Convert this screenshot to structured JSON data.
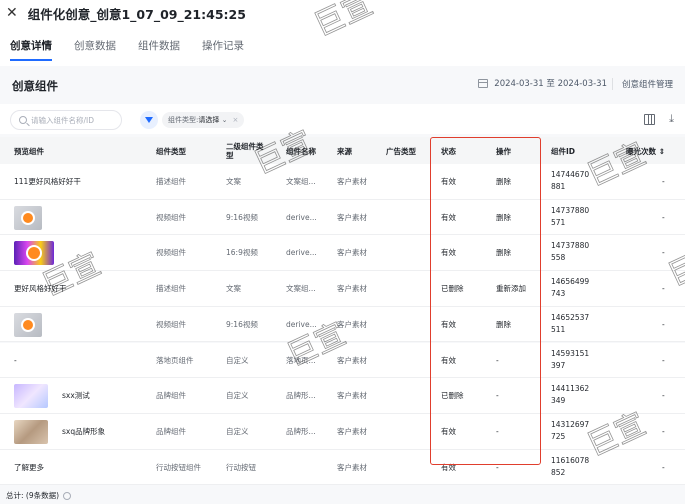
{
  "header": {
    "close_icon": "close-icon",
    "title": "组件化创意_创意1_07_09_21:45:25"
  },
  "tabs": [
    {
      "label": "创意详情"
    },
    {
      "label": "创意数据"
    },
    {
      "label": "组件数据"
    },
    {
      "label": "操作记录"
    }
  ],
  "section": {
    "title": "创意组件",
    "date_range": "2024-03-31 至 2024-03-31",
    "manage_label": "创意组件管理"
  },
  "toolbar": {
    "search_placeholder": "请输入组件名称/ID",
    "filter_prefix": "组件类型:",
    "filter_value": "请选择"
  },
  "columns": [
    "预览组件",
    "组件类型",
    "二级组件类型",
    "组件名称",
    "来源",
    "广告类型",
    "状态",
    "操作",
    "组件ID",
    "曝光次数"
  ],
  "rows": [
    {
      "preview_text": "111更好风格好好干",
      "thumb": "",
      "type": "描述组件",
      "subtype": "文案",
      "name": "文案组...",
      "source": "客户素材",
      "ad_type": "",
      "status": "有效",
      "op": "删除",
      "id1": "14744670",
      "id2": "881",
      "views": "-"
    },
    {
      "preview_text": "",
      "thumb": "video",
      "type": "视频组件",
      "subtype": "9:16视频",
      "name": "derive...",
      "source": "客户素材",
      "ad_type": "",
      "status": "有效",
      "op": "删除",
      "id1": "14737880",
      "id2": "571",
      "views": "-"
    },
    {
      "preview_text": "",
      "thumb": "hor",
      "type": "视频组件",
      "subtype": "16:9视频",
      "name": "derive...",
      "source": "客户素材",
      "ad_type": "",
      "status": "有效",
      "op": "删除",
      "id1": "14737880",
      "id2": "558",
      "views": "-"
    },
    {
      "preview_text": "更好风格好好干",
      "thumb": "",
      "type": "描述组件",
      "subtype": "文案",
      "name": "文案组...",
      "source": "客户素材",
      "ad_type": "",
      "status": "已删除",
      "op": "重新添加",
      "id1": "14656499",
      "id2": "743",
      "views": "-"
    },
    {
      "preview_text": "",
      "thumb": "video",
      "type": "视频组件",
      "subtype": "9:16视频",
      "name": "derive...",
      "source": "客户素材",
      "ad_type": "",
      "status": "有效",
      "op": "删除",
      "id1": "14652537",
      "id2": "511",
      "views": "-"
    },
    {
      "preview_text": "-",
      "thumb": "",
      "type": "落地页组件",
      "subtype": "自定义",
      "name": "落地页...",
      "source": "客户素材",
      "ad_type": "",
      "status": "有效",
      "op": "-",
      "id1": "14593151",
      "id2": "397",
      "views": "-"
    },
    {
      "preview_text": "sxx测试",
      "thumb": "purple",
      "type": "品牌组件",
      "subtype": "自定义",
      "name": "品牌形...",
      "source": "客户素材",
      "ad_type": "",
      "status": "已删除",
      "op": "-",
      "id1": "14411362",
      "id2": "349",
      "views": "-"
    },
    {
      "preview_text": "sxq品牌形象",
      "thumb": "photo",
      "type": "品牌组件",
      "subtype": "自定义",
      "name": "品牌形...",
      "source": "客户素材",
      "ad_type": "",
      "status": "有效",
      "op": "-",
      "id1": "14312697",
      "id2": "725",
      "views": "-"
    },
    {
      "preview_text": "了解更多",
      "thumb": "",
      "type": "行动按钮组件",
      "subtype": "行动按钮",
      "name": "",
      "source": "客户素材",
      "ad_type": "",
      "status": "有效",
      "op": "-",
      "id1": "11616078",
      "id2": "852",
      "views": "-"
    }
  ],
  "footer": {
    "total_label": "总计: (9条数据)"
  },
  "watermark": {
    "text": "巨宣"
  }
}
